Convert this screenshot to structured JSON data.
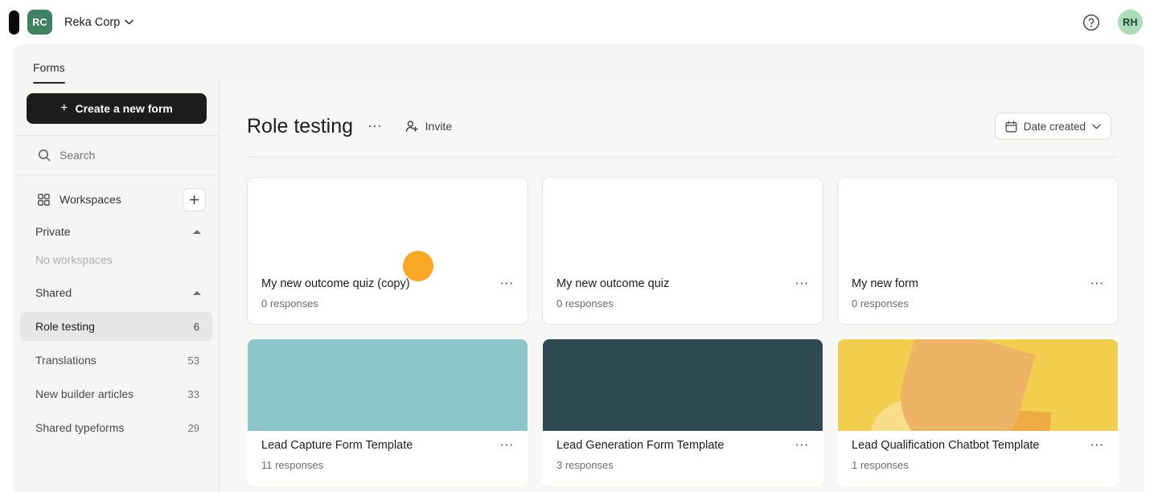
{
  "topbar": {
    "org_initials": "RC",
    "org_name": "Reka Corp",
    "chevron": "⌄",
    "help_icon": "help-circle-icon",
    "user_initials": "RH"
  },
  "tabs": [
    {
      "label": "Forms",
      "active": true
    }
  ],
  "sidebar": {
    "create_button": "Create a new form",
    "create_icon": "plus-icon",
    "search": {
      "placeholder": "Search",
      "icon": "search-icon"
    },
    "workspaces": {
      "label": "Workspaces",
      "icon": "grid-icon",
      "add_icon": "plus-icon",
      "add_title": "Add workspace"
    },
    "groups": [
      {
        "title": "Private",
        "collapsed": false,
        "empty_note": "No workspaces",
        "items": []
      },
      {
        "title": "Shared",
        "collapsed": false,
        "empty_note": "",
        "items": [
          {
            "label": "Role testing",
            "count": "6",
            "active": true
          },
          {
            "label": "Translations",
            "count": "53",
            "active": false
          },
          {
            "label": "New builder articles",
            "count": "33",
            "active": false
          },
          {
            "label": "Shared typeforms",
            "count": "29",
            "active": false
          }
        ]
      }
    ]
  },
  "main": {
    "page_title": "Role testing",
    "title_menu_icon": "ellipsis-icon",
    "invite": {
      "label": "Invite",
      "icon": "person-add-icon"
    },
    "sort": {
      "label": "Date created",
      "icon": "calendar-icon",
      "chevron_icon": "chevron-down-icon"
    },
    "cards": [
      {
        "title": "My new outcome quiz (copy)",
        "responses": "0 responses",
        "thumb_style": "blank",
        "thumb_color": "#ffffff",
        "menu_icon": "ellipsis-icon"
      },
      {
        "title": "My new outcome quiz",
        "responses": "0 responses",
        "thumb_style": "blank",
        "thumb_color": "#ffffff",
        "menu_icon": "ellipsis-icon"
      },
      {
        "title": "My new form",
        "responses": "0 responses",
        "thumb_style": "blank",
        "thumb_color": "#ffffff",
        "menu_icon": "ellipsis-icon"
      },
      {
        "title": "Lead Capture Form Template",
        "responses": "11 responses",
        "thumb_style": "solid",
        "thumb_color": "#8cc6c9",
        "menu_icon": "ellipsis-icon"
      },
      {
        "title": "Lead Generation Form Template",
        "responses": "3 responses",
        "thumb_style": "solid",
        "thumb_color": "#2d4a52",
        "menu_icon": "ellipsis-icon"
      },
      {
        "title": "Lead Qualification Chatbot Template",
        "responses": "1 responses",
        "thumb_style": "shapes",
        "thumb_color": "#f2ce4f",
        "menu_icon": "ellipsis-icon"
      }
    ]
  },
  "overlay": {
    "cursor_highlight_color": "#f9a825"
  },
  "colors": {
    "accent_dark": "#1c1c1c",
    "org_badge": "#3c8260",
    "avatar": "#a8ddb8",
    "sidebar_bg": "#f5f5f4",
    "main_bg": "#f7f7f6",
    "border": "#e6e5e3"
  }
}
